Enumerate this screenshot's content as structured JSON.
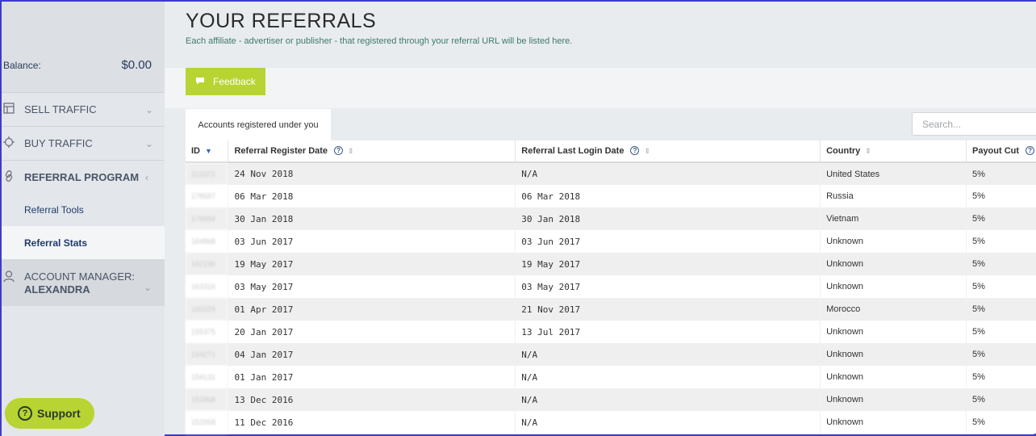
{
  "sidebar": {
    "balance_label": "Balance:",
    "balance_value": "$0.00",
    "items": [
      {
        "label": "SELL TRAFFIC",
        "icon": "layout-icon"
      },
      {
        "label": "BUY TRAFFIC",
        "icon": "crosshair-icon"
      },
      {
        "label": "REFERRAL PROGRAM",
        "icon": "link-icon"
      }
    ],
    "sub_items": [
      {
        "label": "Referral Tools"
      },
      {
        "label": "Referral Stats"
      }
    ],
    "account_manager": {
      "line1": "ACCOUNT MANAGER:",
      "line2": "ALEXANDRA"
    },
    "support_label": "Support"
  },
  "header": {
    "title": "YOUR REFERRALS",
    "subtitle": "Each affiliate - advertiser or publisher - that registered through your referral URL will be listed here."
  },
  "toolbar": {
    "feedback_label": "Feedback"
  },
  "tabs": {
    "active_label": "Accounts registered under you"
  },
  "search": {
    "placeholder": "Search..."
  },
  "table": {
    "columns": [
      "ID",
      "Referral Register Date",
      "Referral Last Login Date",
      "Country",
      "Payout Cut"
    ],
    "rows": [
      {
        "id": "213372",
        "reg": "24 Nov 2018",
        "login": "N/A",
        "country": "United States",
        "cut": "5%"
      },
      {
        "id": "178587",
        "reg": "06 Mar 2018",
        "login": "06 Mar 2018",
        "country": "Russia",
        "cut": "5%"
      },
      {
        "id": "176694",
        "reg": "30 Jan 2018",
        "login": "30 Jan 2018",
        "country": "Vietnam",
        "cut": "5%"
      },
      {
        "id": "164868",
        "reg": "03 Jun 2017",
        "login": "03 Jun 2017",
        "country": "Unknown",
        "cut": "5%"
      },
      {
        "id": "162195",
        "reg": "19 May 2017",
        "login": "19 May 2017",
        "country": "Unknown",
        "cut": "5%"
      },
      {
        "id": "162316",
        "reg": "03 May 2017",
        "login": "03 May 2017",
        "country": "Unknown",
        "cut": "5%"
      },
      {
        "id": "160229",
        "reg": "01 Apr 2017",
        "login": "21 Nov 2017",
        "country": "Morocco",
        "cut": "5%"
      },
      {
        "id": "155375",
        "reg": "20 Jan 2017",
        "login": "13 Jul 2017",
        "country": "Unknown",
        "cut": "5%"
      },
      {
        "id": "154271",
        "reg": "04 Jan 2017",
        "login": "N/A",
        "country": "Unknown",
        "cut": "5%"
      },
      {
        "id": "154131",
        "reg": "01 Jan 2017",
        "login": "N/A",
        "country": "Unknown",
        "cut": "5%"
      },
      {
        "id": "153968",
        "reg": "13 Dec 2016",
        "login": "N/A",
        "country": "Unknown",
        "cut": "5%"
      },
      {
        "id": "152958",
        "reg": "11 Dec 2016",
        "login": "N/A",
        "country": "Unknown",
        "cut": "5%"
      }
    ]
  },
  "colors": {
    "accent": "#b8d432",
    "link": "#1e3a6a",
    "subtitle": "#3c7a6a"
  }
}
